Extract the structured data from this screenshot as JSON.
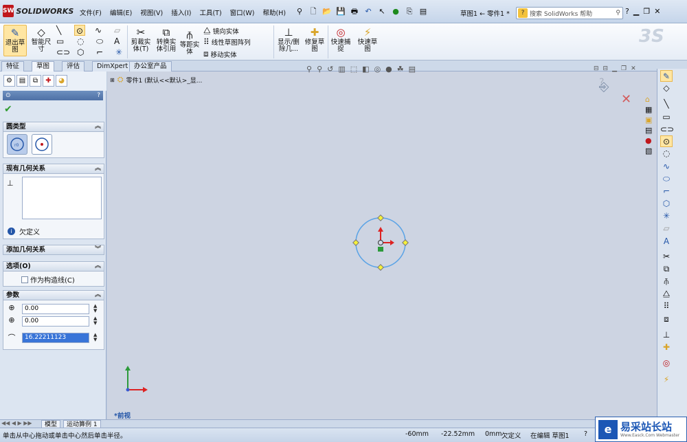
{
  "app": {
    "logo_text": "SOLIDWORKS",
    "logo_mark": "SW"
  },
  "menu": [
    "文件(F)",
    "编辑(E)",
    "视图(V)",
    "插入(I)",
    "工具(T)",
    "窗口(W)",
    "帮助(H)"
  ],
  "doc_title": "草图1 ← 零件1 *",
  "search": {
    "placeholder": "搜索 SolidWorks 帮助"
  },
  "ribbon": {
    "exit_sketch": "退出草\n图",
    "smart_dim": "智能尺\n寸",
    "trim": "剪裁实\n体(T)",
    "convert": "转换实\n体引用",
    "offset": "等距实\n体",
    "mirror": "镜向实体",
    "linear_pattern": "线性草图阵列",
    "move": "移动实体",
    "show_delete": "显示/删\n除几...",
    "repair": "修复草\n图",
    "quick_snap": "快速捕\n捉",
    "rapid_sketch": "快速草\n图"
  },
  "tabs": [
    "特征",
    "草图",
    "评估",
    "DimXpert",
    "办公室产品"
  ],
  "active_tab": "草图",
  "feature_tree": {
    "root_label": "零件1  (默认<<默认>_显..."
  },
  "panel": {
    "header": "",
    "circle_type": {
      "title": "圆类型"
    },
    "existing_relations": {
      "title": "现有几何关系",
      "status": "欠定义"
    },
    "add_relations": {
      "title": "添加几何关系"
    },
    "options": {
      "title": "选项(O)",
      "construction": "作为构造线(C)"
    },
    "params": {
      "title": "参数",
      "cx": "0.00",
      "cy": "0.00",
      "radius": "16.22211123"
    }
  },
  "view_label": "*前视",
  "bottom_tabs": [
    "模型",
    "运动算例 1"
  ],
  "status": {
    "hint": "单击从中心拖动或单击中心然后单击半径。",
    "x": "-60mm",
    "y": "-22.52mm",
    "z": "0mm",
    "state": "欠定义",
    "mode": "在编辑 草图1"
  },
  "watermark": {
    "title": "易采站长站",
    "sub": "Www.Easck.Com Webmaster"
  },
  "colors": {
    "accent": "#4e70a5",
    "circle": "#5aa3e6",
    "handle": "#f5f03a"
  }
}
